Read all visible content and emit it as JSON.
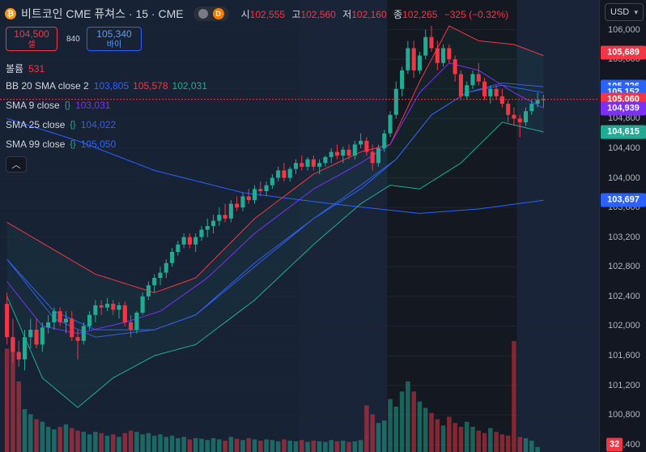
{
  "header": {
    "coin_glyph": "₿",
    "title": "비트코인 CME 퓨쳐스 · 15 · CME",
    "badge_glyph": "D",
    "ohlc": [
      {
        "label": "시",
        "value": "102,555"
      },
      {
        "label": "고",
        "value": "102,560"
      },
      {
        "label": "저",
        "value": "102,160"
      },
      {
        "label": "종",
        "value": "102,265"
      }
    ],
    "change": "−325 (−0.32%)"
  },
  "trade": {
    "sell_price": "104,500",
    "sell_label": "셀",
    "spread": "840",
    "buy_price": "105,340",
    "buy_label": "바이"
  },
  "indicators": {
    "volume": {
      "name": "볼륨",
      "value": "531"
    },
    "bb": {
      "name": "BB 20 SMA close 2",
      "basis": "103,805",
      "upper": "105,578",
      "lower": "102,031"
    },
    "sma9": {
      "name": "SMA 9 close",
      "value": "103,031"
    },
    "sma25": {
      "name": "SMA 25 close",
      "value": "104,022"
    },
    "sma99": {
      "name": "SMA 99 close",
      "value": "105,050"
    }
  },
  "currency": "USD",
  "collapse_glyph": "︿",
  "colors": {
    "up": "#22ab94",
    "down": "#f23645",
    "bb_upper": "#f23645",
    "bb_basis": "#2962ff",
    "bb_lower": "#22ab94",
    "sma9": "#7b2ff7",
    "sma25": "#3b5bdb",
    "sma99": "#2962ff"
  },
  "chart_data": {
    "type": "candlestick",
    "ylim": [
      100300,
      106400
    ],
    "y_ticks": [
      106000,
      105600,
      105200,
      104800,
      104400,
      104000,
      103600,
      103200,
      102800,
      102400,
      102000,
      101600,
      101200,
      100800,
      100400
    ],
    "y_tick_labels": [
      "106,000",
      "105,600",
      "105,200",
      "104,800",
      "104,400",
      "104,000",
      "103,600",
      "103,200",
      "102,800",
      "102,400",
      "102,000",
      "101,600",
      "101,200",
      "100,800",
      "100,400"
    ],
    "price_labels": [
      {
        "value": 105689,
        "text": "105,689",
        "color": "#f23645"
      },
      {
        "value": 105226,
        "text": "105,226",
        "color": "#2962ff"
      },
      {
        "value": 105152,
        "text": "105,152",
        "color": "#2962ff"
      },
      {
        "value": 105060,
        "text": "105,060",
        "color": "#f23645"
      },
      {
        "value": 104939,
        "text": "104,939",
        "color": "#7b2ff7"
      },
      {
        "value": 104615,
        "text": "104,615",
        "color": "#22ab94"
      },
      {
        "value": 103697,
        "text": "103,697",
        "color": "#2962ff"
      }
    ],
    "current_price": 105060,
    "volume_current": "32",
    "candles": [
      [
        102300,
        102450,
        101750,
        101850
      ],
      [
        101850,
        102100,
        101500,
        101650
      ],
      [
        101650,
        101800,
        101450,
        101550
      ],
      [
        101550,
        101950,
        101400,
        101850
      ],
      [
        101850,
        102100,
        101700,
        101950
      ],
      [
        101950,
        102100,
        101700,
        101750
      ],
      [
        101750,
        102050,
        101650,
        101980
      ],
      [
        101980,
        102150,
        101900,
        102050
      ],
      [
        102050,
        102250,
        101950,
        102200
      ],
      [
        102200,
        102250,
        102000,
        102050
      ],
      [
        102050,
        102200,
        101900,
        102100
      ],
      [
        102100,
        102200,
        101800,
        101850
      ],
      [
        101850,
        101950,
        101550,
        101800
      ],
      [
        101800,
        102050,
        101750,
        102000
      ],
      [
        102000,
        102200,
        101950,
        102150
      ],
      [
        102150,
        102350,
        102050,
        102280
      ],
      [
        102280,
        102350,
        102150,
        102250
      ],
      [
        102250,
        102380,
        102200,
        102300
      ],
      [
        102300,
        102350,
        102150,
        102220
      ],
      [
        102220,
        102320,
        102100,
        102280
      ],
      [
        102280,
        102330,
        102000,
        102050
      ],
      [
        102050,
        102150,
        101850,
        101950
      ],
      [
        101950,
        102200,
        101900,
        102180
      ],
      [
        102180,
        102450,
        102150,
        102400
      ],
      [
        102400,
        102600,
        102350,
        102550
      ],
      [
        102550,
        102700,
        102450,
        102650
      ],
      [
        102650,
        102800,
        102550,
        102720
      ],
      [
        102720,
        102900,
        102650,
        102850
      ],
      [
        102850,
        103050,
        102800,
        103000
      ],
      [
        103000,
        103150,
        102950,
        103100
      ],
      [
        103100,
        103250,
        103050,
        103200
      ],
      [
        103200,
        103250,
        103050,
        103100
      ],
      [
        103100,
        103250,
        103000,
        103200
      ],
      [
        103200,
        103350,
        103150,
        103300
      ],
      [
        103300,
        103450,
        103200,
        103350
      ],
      [
        103350,
        103500,
        103250,
        103420
      ],
      [
        103420,
        103600,
        103350,
        103500
      ],
      [
        103500,
        103650,
        103400,
        103450
      ],
      [
        103450,
        103700,
        103400,
        103650
      ],
      [
        103650,
        103750,
        103550,
        103600
      ],
      [
        103600,
        103800,
        103550,
        103750
      ],
      [
        103750,
        103850,
        103650,
        103700
      ],
      [
        103700,
        103900,
        103650,
        103850
      ],
      [
        103850,
        103950,
        103750,
        103820
      ],
      [
        103820,
        103950,
        103750,
        103900
      ],
      [
        103900,
        104050,
        103850,
        104000
      ],
      [
        104000,
        104150,
        103950,
        104100
      ],
      [
        104100,
        104200,
        103950,
        104000
      ],
      [
        104000,
        104150,
        103950,
        104120
      ],
      [
        104120,
        104250,
        104050,
        104200
      ],
      [
        104200,
        104300,
        104100,
        104150
      ],
      [
        104150,
        104280,
        104100,
        104250
      ],
      [
        104250,
        104300,
        104100,
        104150
      ],
      [
        104150,
        104250,
        104050,
        104200
      ],
      [
        104200,
        104300,
        104150,
        104280
      ],
      [
        104280,
        104400,
        104200,
        104350
      ],
      [
        104350,
        104450,
        104250,
        104300
      ],
      [
        104300,
        104420,
        104200,
        104380
      ],
      [
        104380,
        104450,
        104250,
        104300
      ],
      [
        104300,
        104500,
        104250,
        104450
      ],
      [
        104450,
        104600,
        104400,
        104500
      ],
      [
        104500,
        104550,
        104300,
        104350
      ],
      [
        104350,
        104450,
        104100,
        104200
      ],
      [
        104200,
        104450,
        104150,
        104400
      ],
      [
        104400,
        104650,
        104350,
        104600
      ],
      [
        104600,
        104900,
        104550,
        104850
      ],
      [
        104850,
        105300,
        104800,
        105200
      ],
      [
        105200,
        105500,
        105100,
        105450
      ],
      [
        105450,
        105850,
        105400,
        105750
      ],
      [
        105750,
        105850,
        105350,
        105450
      ],
      [
        105450,
        105700,
        105400,
        105650
      ],
      [
        105650,
        106000,
        105600,
        105900
      ],
      [
        105900,
        106050,
        105700,
        105750
      ],
      [
        105750,
        105850,
        105450,
        105550
      ],
      [
        105550,
        105800,
        105500,
        105750
      ],
      [
        105750,
        105800,
        105550,
        105600
      ],
      [
        105600,
        105650,
        105300,
        105400
      ],
      [
        105400,
        105450,
        105050,
        105100
      ],
      [
        105100,
        105300,
        105050,
        105250
      ],
      [
        105250,
        105450,
        105200,
        105400
      ],
      [
        105400,
        105550,
        105250,
        105300
      ],
      [
        105300,
        105350,
        105050,
        105100
      ],
      [
        105100,
        105250,
        105000,
        105200
      ],
      [
        105200,
        105250,
        105050,
        105100
      ],
      [
        105100,
        105200,
        104950,
        105000
      ],
      [
        105000,
        105050,
        104750,
        104850
      ],
      [
        104850,
        104950,
        104700,
        104800
      ],
      [
        104800,
        104850,
        104550,
        104750
      ],
      [
        104750,
        104950,
        104700,
        104900
      ],
      [
        104900,
        105050,
        104850,
        105000
      ],
      [
        105000,
        105150,
        104950,
        105050
      ],
      [
        105050,
        105120,
        104950,
        105060
      ]
    ],
    "volumes": [
      820,
      900,
      560,
      340,
      300,
      260,
      240,
      200,
      180,
      200,
      220,
      190,
      170,
      160,
      140,
      160,
      150,
      130,
      140,
      120,
      150,
      170,
      160,
      140,
      150,
      130,
      140,
      120,
      130,
      110,
      120,
      100,
      110,
      105,
      95,
      110,
      100,
      90,
      120,
      105,
      95,
      110,
      100,
      90,
      100,
      95,
      85,
      100,
      90,
      85,
      95,
      80,
      90,
      85,
      80,
      95,
      85,
      90,
      80,
      85,
      95,
      370,
      300,
      230,
      250,
      420,
      360,
      480,
      560,
      480,
      400,
      350,
      310,
      260,
      210,
      280,
      230,
      200,
      240,
      200,
      170,
      150,
      190,
      160,
      140,
      130,
      880,
      120,
      110,
      90,
      40
    ],
    "bb_upper": [
      [
        0,
        103400
      ],
      [
        15,
        102700
      ],
      [
        25,
        102450
      ],
      [
        32,
        102650
      ],
      [
        42,
        103450
      ],
      [
        52,
        104050
      ],
      [
        60,
        104350
      ],
      [
        65,
        104450
      ],
      [
        70,
        105300
      ],
      [
        75,
        106050
      ],
      [
        80,
        105850
      ],
      [
        86,
        105800
      ],
      [
        91,
        105650
      ]
    ],
    "bb_basis": [
      [
        0,
        102900
      ],
      [
        8,
        102200
      ],
      [
        15,
        101950
      ],
      [
        25,
        101950
      ],
      [
        32,
        102150
      ],
      [
        42,
        102850
      ],
      [
        52,
        103450
      ],
      [
        60,
        103850
      ],
      [
        66,
        104250
      ],
      [
        72,
        104850
      ],
      [
        78,
        105150
      ],
      [
        84,
        105250
      ],
      [
        91,
        105150
      ]
    ],
    "bb_lower": [
      [
        0,
        102400
      ],
      [
        6,
        101300
      ],
      [
        12,
        100900
      ],
      [
        18,
        101300
      ],
      [
        25,
        101600
      ],
      [
        32,
        101750
      ],
      [
        42,
        102350
      ],
      [
        52,
        103100
      ],
      [
        60,
        103650
      ],
      [
        65,
        103900
      ],
      [
        70,
        103850
      ],
      [
        77,
        104200
      ],
      [
        84,
        104750
      ],
      [
        91,
        104620
      ]
    ],
    "sma9": [
      [
        0,
        102600
      ],
      [
        6,
        102000
      ],
      [
        12,
        101900
      ],
      [
        20,
        102050
      ],
      [
        26,
        102200
      ],
      [
        34,
        102650
      ],
      [
        42,
        103250
      ],
      [
        52,
        103850
      ],
      [
        60,
        104200
      ],
      [
        65,
        104450
      ],
      [
        70,
        105150
      ],
      [
        75,
        105550
      ],
      [
        80,
        105450
      ],
      [
        86,
        105150
      ],
      [
        91,
        104940
      ]
    ],
    "sma25": [
      [
        0,
        102900
      ],
      [
        8,
        102100
      ],
      [
        15,
        101850
      ],
      [
        25,
        101950
      ],
      [
        32,
        102150
      ],
      [
        42,
        102800
      ],
      [
        52,
        103450
      ],
      [
        60,
        103900
      ],
      [
        66,
        104250
      ],
      [
        72,
        104850
      ],
      [
        78,
        105150
      ],
      [
        84,
        105280
      ],
      [
        91,
        105230
      ]
    ],
    "sma99": [
      [
        0,
        104800
      ],
      [
        12,
        104500
      ],
      [
        25,
        104100
      ],
      [
        40,
        103800
      ],
      [
        55,
        103650
      ],
      [
        70,
        103520
      ],
      [
        80,
        103580
      ],
      [
        91,
        103697
      ]
    ]
  }
}
